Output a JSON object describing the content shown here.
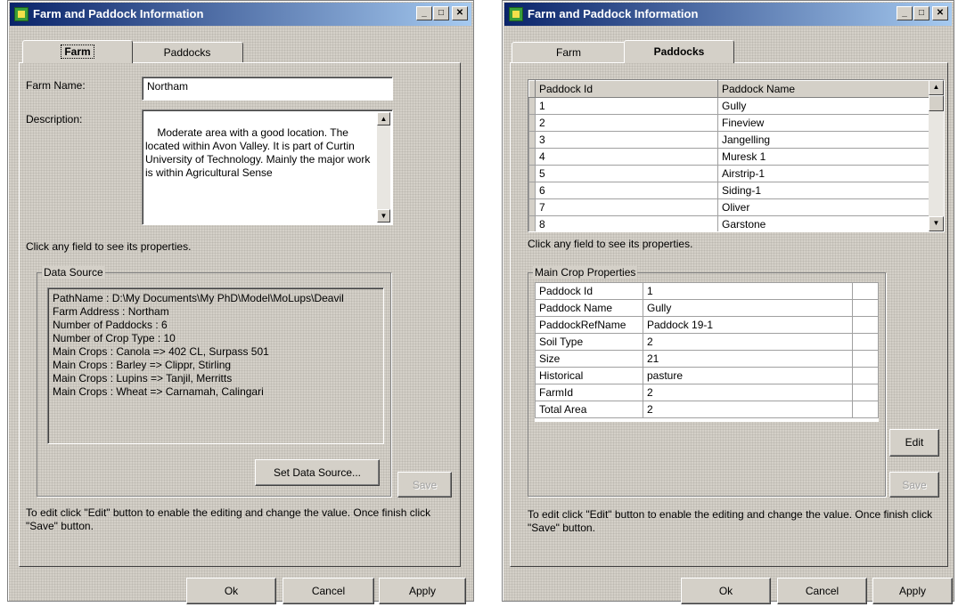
{
  "left_window": {
    "title": "Farm and Paddock Information",
    "tabs": [
      "Farm",
      "Paddocks"
    ],
    "farm_name_label": "Farm Name:",
    "farm_name_value": "Northam",
    "description_label": "Description:",
    "description_value": "Moderate area with a good location. The located within Avon Valley. It is part of Curtin University of Technology. Mainly the major work is within Agricultural Sense",
    "hint": "Click any field to see its properties.",
    "data_source_label": "Data Source",
    "data_source_lines": [
      "PathName : D:\\My Documents\\My PhD\\Model\\MoLups\\Deavil",
      "Farm Address : Northam",
      "Number of Paddocks : 6",
      "Number of Crop Type : 10",
      "Main Crops : Canola => 402 CL, Surpass 501",
      "Main Crops : Barley => Clippr, Stirling",
      "Main Crops : Lupins => Tanjil, Merritts",
      "Main Crops : Wheat => Carnamah, Calingari"
    ],
    "set_data_source_button": "Set Data Source...",
    "save_button": "Save",
    "edit_note": "To edit click \"Edit\" button to enable the editing and change the value. Once finish click \"Save\" button.",
    "ok_button": "Ok",
    "cancel_button": "Cancel",
    "apply_button": "Apply"
  },
  "right_window": {
    "title": "Farm and Paddock Information",
    "tabs": [
      "Farm",
      "Paddocks"
    ],
    "grid_headers": [
      "Paddock Id",
      "Paddock Name"
    ],
    "grid_rows": [
      [
        "1",
        "Gully"
      ],
      [
        "2",
        "Fineview"
      ],
      [
        "3",
        "Jangelling"
      ],
      [
        "4",
        "Muresk 1"
      ],
      [
        "5",
        "Airstrip-1"
      ],
      [
        "6",
        "Siding-1"
      ],
      [
        "7",
        "Oliver"
      ],
      [
        "8",
        "Garstone"
      ]
    ],
    "hint": "Click any field to see its properties.",
    "props_label": "Main Crop Properties",
    "props": [
      [
        "Paddock Id",
        "1"
      ],
      [
        "Paddock Name",
        "Gully"
      ],
      [
        "PaddockRefName",
        "Paddock 19-1"
      ],
      [
        "Soil Type",
        "2"
      ],
      [
        "Size",
        "21"
      ],
      [
        "Historical",
        "pasture"
      ],
      [
        "FarmId",
        "2"
      ],
      [
        "Total Area",
        "2"
      ]
    ],
    "edit_button": "Edit",
    "save_button": "Save",
    "edit_note": "To edit click \"Edit\" button to enable the editing and change the value. Once finish click \"Save\" button.",
    "ok_button": "Ok",
    "cancel_button": "Cancel",
    "apply_button": "Apply"
  }
}
